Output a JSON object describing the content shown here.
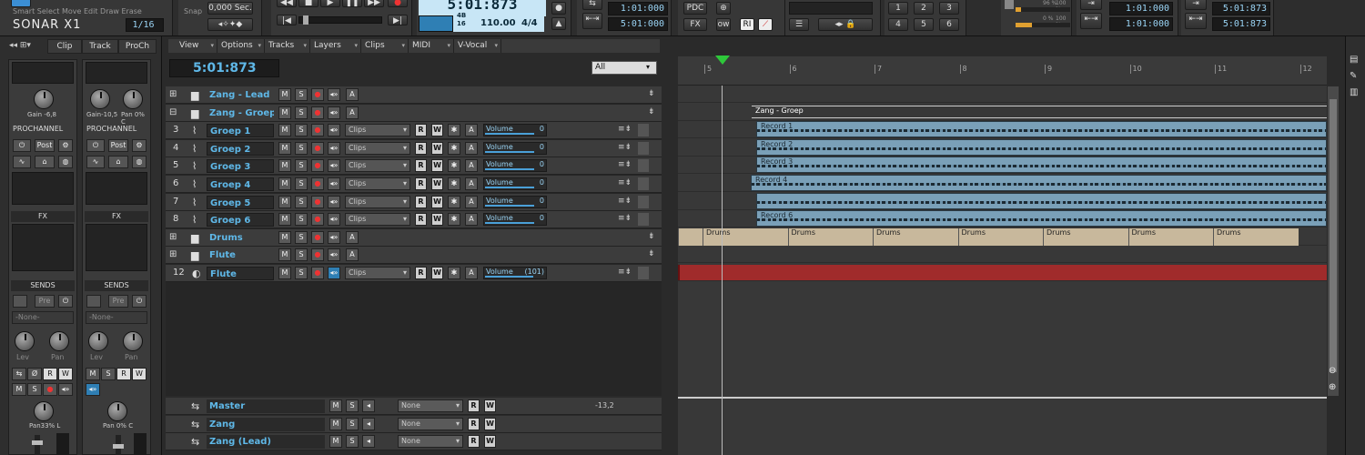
{
  "app": {
    "brand": "SONAR X1",
    "snap_value": "0,000 Sec.",
    "snap_label": "Snap"
  },
  "tools": [
    "Smart",
    "Select",
    "Move",
    "Edit",
    "Draw",
    "Erase"
  ],
  "transport": {
    "time": "5:01:873",
    "tempo": "110.00",
    "meter": "4/4",
    "meter_top": "4B",
    "meter_bottom": "16",
    "snap_fraction": "1/16"
  },
  "loop": {
    "start": "1:01:000",
    "end": "5:01:000"
  },
  "punch": {
    "start": "1:01:000",
    "end": "1:01:000"
  },
  "select": {
    "start": "5:01:873",
    "end": "5:01:873"
  },
  "misc": {
    "pdc": "PDC",
    "fx": "FX",
    "ri": "RI",
    "screensets": [
      "1",
      "2",
      "3",
      "4",
      "5",
      "6"
    ],
    "meter_values": [
      "96 %",
      "100 %",
      "0 %",
      "100 %"
    ]
  },
  "inspector": {
    "tabs": [
      "Clip",
      "Track",
      "ProCh"
    ],
    "strips": [
      {
        "gain": "Gain -6,8",
        "pan_top": "",
        "prochannel": "PROCHANNEL",
        "post": "Post",
        "fx": "FX",
        "sends": "SENDS",
        "pre": "Pre",
        "none": "-None-",
        "lev": "Lev",
        "pan": "Pan",
        "pan_bottom": "Pan33% L"
      },
      {
        "gain": "Gain-10,5",
        "pan_top": "Pan 0% C",
        "prochannel": "PROCHANNEL",
        "post": "Post",
        "fx": "FX",
        "sends": "SENDS",
        "pre": "Pre",
        "none": "-None-",
        "lev": "Lev",
        "pan": "Pan",
        "pan_bottom": "Pan 0% C"
      }
    ]
  },
  "menus": [
    "View",
    "Options",
    "Tracks",
    "Layers",
    "Clips",
    "MIDI",
    "V-Vocal"
  ],
  "track_view": {
    "now_time": "5:01:873",
    "filter": "All"
  },
  "ruler": [
    "5",
    "6",
    "7",
    "8",
    "9",
    "10",
    "11",
    "12"
  ],
  "tracks": [
    {
      "num": "",
      "type": "folder",
      "name": "Zang - Lead"
    },
    {
      "num": "",
      "type": "folder",
      "name": "Zang - Groep"
    },
    {
      "num": "3",
      "type": "audio",
      "name": "Groep 1",
      "clips": "Clips",
      "volume_label": "Volume",
      "volume": "0"
    },
    {
      "num": "4",
      "type": "audio",
      "name": "Groep 2",
      "clips": "Clips",
      "volume_label": "Volume",
      "volume": "0"
    },
    {
      "num": "5",
      "type": "audio",
      "name": "Groep 3",
      "clips": "Clips",
      "volume_label": "Volume",
      "volume": "0"
    },
    {
      "num": "6",
      "type": "audio",
      "name": "Groep 4",
      "clips": "Clips",
      "volume_label": "Volume",
      "volume": "0"
    },
    {
      "num": "7",
      "type": "audio",
      "name": "Groep 5",
      "clips": "Clips",
      "volume_label": "Volume",
      "volume": "0"
    },
    {
      "num": "8",
      "type": "audio",
      "name": "Groep 6",
      "clips": "Clips",
      "volume_label": "Volume",
      "volume": "0"
    },
    {
      "num": "",
      "type": "folder",
      "name": "Drums"
    },
    {
      "num": "",
      "type": "folder",
      "name": "Flute"
    },
    {
      "num": "12",
      "type": "midi",
      "name": "Flute",
      "clips": "Clips",
      "volume_label": "Volume",
      "volume": "(101)"
    }
  ],
  "clips": {
    "group_label": "Zang - Groep",
    "records": [
      "Record 1",
      "Record 2",
      "Record 3",
      "Record 4",
      "",
      "Record 6"
    ],
    "drums": [
      "Drums",
      "Drums",
      "Drums",
      "Drums",
      "Drums",
      "Drums",
      "Drums",
      "Drums"
    ]
  },
  "buses": [
    {
      "name": "Master",
      "output": "None",
      "level": "-13,2"
    },
    {
      "name": "Zang",
      "output": "None",
      "level": ""
    },
    {
      "name": "Zang (Lead)",
      "output": "None",
      "level": ""
    }
  ],
  "buttons": {
    "m": "M",
    "s": "S",
    "a": "A",
    "r": "R",
    "w": "W"
  },
  "colors": {
    "accent_blue": "#5fb8e8",
    "record_red": "#e33333",
    "clip_blue": "#7aa0b8",
    "drum_clip": "#c8b89c",
    "midi_red": "#a02b2b"
  }
}
